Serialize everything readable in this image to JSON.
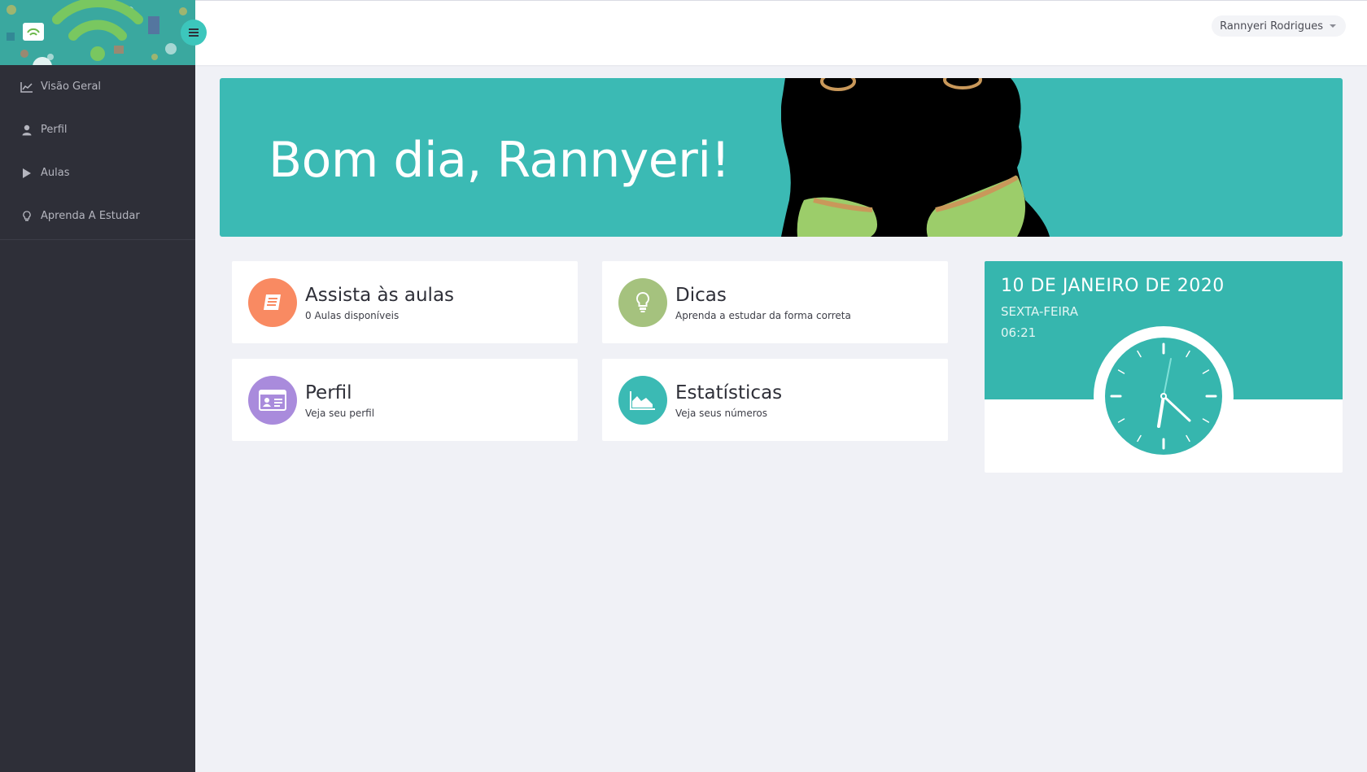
{
  "sidebar": {
    "items": [
      {
        "label": "Visão Geral",
        "icon": "line-chart-icon"
      },
      {
        "label": "Perfil",
        "icon": "user-icon"
      },
      {
        "label": "Aulas",
        "icon": "play-icon"
      },
      {
        "label": "Aprenda A Estudar",
        "icon": "lightbulb-icon"
      }
    ]
  },
  "header": {
    "user_name": "Rannyeri Rodrigues"
  },
  "hero": {
    "greeting": "Bom dia, Rannyeri!"
  },
  "cards": [
    {
      "title": "Assista às aulas",
      "subtitle": "0 Aulas disponíveis",
      "icon": "book-icon",
      "color": "#f98a62"
    },
    {
      "title": "Dicas",
      "subtitle": "Aprenda a estudar da forma correta",
      "icon": "lightbulb-icon",
      "color": "#a5c27e"
    },
    {
      "title": "Perfil",
      "subtitle": "Veja seu perfil",
      "icon": "id-card-icon",
      "color": "#a98bdc"
    },
    {
      "title": "Estatísticas",
      "subtitle": "Veja seus números",
      "icon": "area-chart-icon",
      "color": "#3bbab4"
    }
  ],
  "date_widget": {
    "date": "10 DE JANEIRO DE 2020",
    "weekday": "SEXTA-FEIRA",
    "time": "06:21"
  },
  "colors": {
    "sidebar_bg": "#2e2f38",
    "accent": "#3bbab4",
    "page_bg": "#f0f1f6"
  }
}
